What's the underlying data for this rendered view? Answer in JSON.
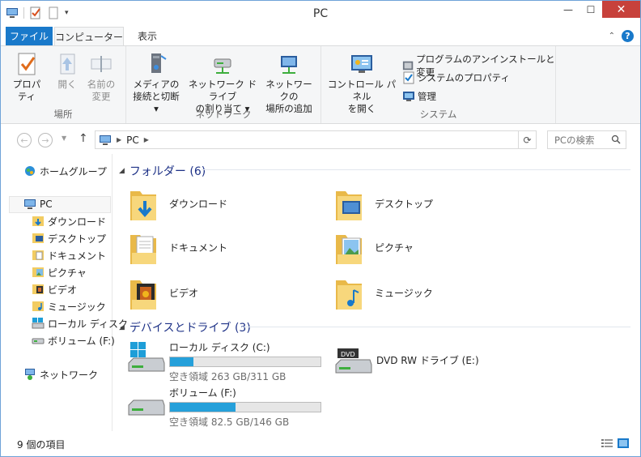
{
  "window": {
    "title": "PC"
  },
  "ribbon_tabs": {
    "file": "ファイル",
    "computer": "コンピューター",
    "view": "表示"
  },
  "ribbon": {
    "location": {
      "label": "場所",
      "properties": "プロパティ",
      "open": "開く",
      "rename_line1": "名前の",
      "rename_line2": "変更"
    },
    "network": {
      "label": "ネットワーク",
      "media_line1": "メディアの",
      "media_line2": "接続と切断 ▾",
      "mapdrive_line1": "ネットワーク ドライブ",
      "mapdrive_line2": "の割り当て ▾",
      "addloc_line1": "ネットワークの",
      "addloc_line2": "場所の追加"
    },
    "system": {
      "label": "システム",
      "control_line1": "コントロール パネル",
      "control_line2": "を開く",
      "uninstall": "プログラムのアンインストールと変更",
      "sysprops": "システムのプロパティ",
      "manage": "管理"
    }
  },
  "address": {
    "path_root": "PC",
    "search_placeholder": "PCの検索"
  },
  "nav": {
    "homegroup": "ホームグループ",
    "pc": "PC",
    "items": [
      {
        "label": "ダウンロード",
        "icon": "download-folder-icon"
      },
      {
        "label": "デスクトップ",
        "icon": "desktop-folder-icon"
      },
      {
        "label": "ドキュメント",
        "icon": "documents-folder-icon"
      },
      {
        "label": "ピクチャ",
        "icon": "pictures-folder-icon"
      },
      {
        "label": "ビデオ",
        "icon": "videos-folder-icon"
      },
      {
        "label": "ミュージック",
        "icon": "music-folder-icon"
      },
      {
        "label": "ローカル ディスク",
        "icon": "hard-drive-icon"
      },
      {
        "label": "ボリューム (F:)",
        "icon": "removable-drive-icon"
      }
    ],
    "network": "ネットワーク"
  },
  "content": {
    "folders_header": "フォルダー (6)",
    "folders": [
      {
        "label": "ダウンロード"
      },
      {
        "label": "デスクトップ"
      },
      {
        "label": "ドキュメント"
      },
      {
        "label": "ピクチャ"
      },
      {
        "label": "ビデオ"
      },
      {
        "label": "ミュージック"
      }
    ],
    "drives_header": "デバイスとドライブ (3)",
    "drives": [
      {
        "name": "ローカル ディスク (C:)",
        "free": "空き領域 263 GB/311 GB",
        "used_fraction": 0.154
      },
      {
        "name": "DVD RW ドライブ (E:)"
      },
      {
        "name": "ボリューム (F:)",
        "free": "空き領域 82.5 GB/146 GB",
        "used_fraction": 0.435
      }
    ]
  },
  "status": {
    "items": "9 個の項目"
  },
  "colors": {
    "accent": "#1979ca",
    "close": "#c7413b",
    "progress": "#26a0da",
    "header_text": "#1e3287"
  }
}
